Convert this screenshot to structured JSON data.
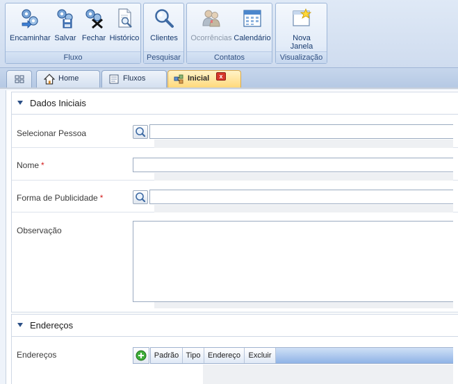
{
  "ribbon": {
    "groups": [
      {
        "label": "Fluxo",
        "buttons": [
          {
            "label": "Encaminhar",
            "icon": "forward-gears-icon"
          },
          {
            "label": "Salvar",
            "icon": "save-gears-icon"
          },
          {
            "label": "Fechar",
            "icon": "close-gears-icon"
          },
          {
            "label": "Histórico",
            "icon": "history-document-icon"
          }
        ]
      },
      {
        "label": "Pesquisar",
        "buttons": [
          {
            "label": "Clientes",
            "icon": "magnifier-icon"
          }
        ]
      },
      {
        "label": "Contatos",
        "buttons": [
          {
            "label": "Ocorrências",
            "icon": "people-icon",
            "disabled": true
          },
          {
            "label": "Calendário",
            "icon": "calendar-icon"
          }
        ]
      },
      {
        "label": "Visualização",
        "buttons": [
          {
            "label": "Nova\nJanela",
            "icon": "new-window-icon"
          }
        ]
      }
    ]
  },
  "tabs": [
    {
      "label": "",
      "icon": "grid-icon"
    },
    {
      "label": "Home",
      "icon": "home-icon"
    },
    {
      "label": "Fluxos",
      "icon": "form-icon"
    },
    {
      "label": "Inicial",
      "icon": "flow-icon",
      "active": true,
      "closable": true,
      "close_label": "x"
    }
  ],
  "sections": {
    "dados": {
      "title": "Dados Iniciais",
      "fields": {
        "pessoa": {
          "label": "Selecionar Pessoa",
          "value": ""
        },
        "nome": {
          "label": "Nome",
          "required": "*",
          "value": ""
        },
        "publicidade": {
          "label": "Forma de Publicidade",
          "required": "*",
          "value": ""
        },
        "observacao": {
          "label": "Observação",
          "value": ""
        }
      }
    },
    "enderecos": {
      "title": "Endereços",
      "field_label": "Endereços",
      "columns": [
        "Padrão",
        "Tipo",
        "Endereço",
        "Excluir"
      ]
    }
  },
  "colors": {
    "accent": "#ffd97c",
    "required": "#d21a1a",
    "ribbon_text": "#173a6e"
  }
}
